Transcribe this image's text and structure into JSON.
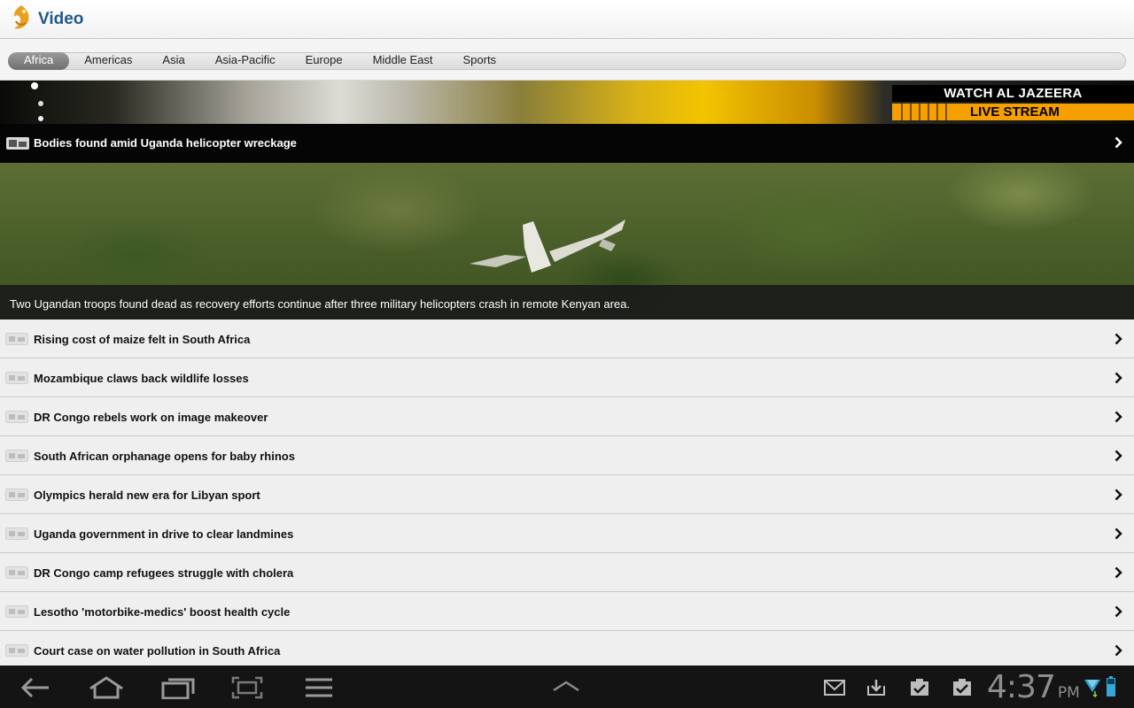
{
  "app": {
    "title": "Video"
  },
  "tabs": [
    {
      "label": "Africa",
      "active": true
    },
    {
      "label": "Americas",
      "active": false
    },
    {
      "label": "Asia",
      "active": false
    },
    {
      "label": "Asia-Pacific",
      "active": false
    },
    {
      "label": "Europe",
      "active": false
    },
    {
      "label": "Middle East",
      "active": false
    },
    {
      "label": "Sports",
      "active": false
    }
  ],
  "banner": {
    "line1": "WATCH AL JAZEERA",
    "line2": "LIVE STREAM"
  },
  "featured": {
    "title": "Bodies found amid Uganda helicopter wreckage",
    "caption": "Two Ugandan troops found dead as recovery efforts continue after three military helicopters crash in remote Kenyan area."
  },
  "videos": [
    {
      "title": "Rising cost of maize felt in South Africa"
    },
    {
      "title": "Mozambique claws back wildlife losses"
    },
    {
      "title": "DR Congo rebels work on image makeover"
    },
    {
      "title": "South African orphanage opens for baby rhinos"
    },
    {
      "title": "Olympics herald new era for Libyan sport"
    },
    {
      "title": "Uganda government in drive to clear landmines"
    },
    {
      "title": "DR Congo camp refugees struggle with cholera"
    },
    {
      "title": "Lesotho 'motorbike-medics' boost health cycle"
    },
    {
      "title": "Court case on water pollution in South Africa"
    }
  ],
  "system_bar": {
    "time": "4:37",
    "ampm": "PM",
    "nav_icons": [
      "back-icon",
      "home-icon",
      "recent-apps-icon",
      "screenshot-icon",
      "menu-icon"
    ],
    "notification_icons": [
      "gmail-icon",
      "download-icon",
      "task-done-icon",
      "task-done-icon"
    ]
  },
  "colors": {
    "title": "#1e5a8c",
    "live_orange": "#f6a000"
  }
}
